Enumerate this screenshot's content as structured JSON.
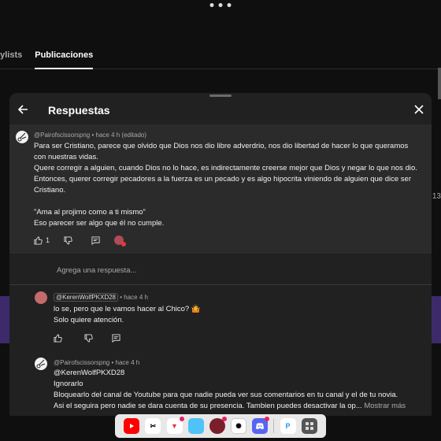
{
  "background": {
    "tab_prev": "aylists",
    "tab_active": "Publicaciones",
    "side_count": "13"
  },
  "panel": {
    "title": "Respuestas",
    "parent_comment": {
      "author": "@Pairofscissorspng",
      "time": "hace 4 h (editado)",
      "paragraphs": [
        "Para ser Cristiano, parece que olvido que Dios nos dio libre adverdrio, nos dio libertad de hacer lo que queramos con nuestras vidas.",
        "Quere corregir a alguien, cuando Dios no lo hace, es indirectamente creerse mejor que Dios y negar lo que nos dio. Entonces, querer corregir pecadores a la fuerza es un pecado y es algo hipocrita viniendo de alguien que dice ser Cristiano.",
        "",
        "\"Ama al projimo como a ti mismo\"",
        "Eso parecer ser algo que él no cumple."
      ],
      "likes": "1"
    },
    "reply_placeholder": "Agrega una respuesta...",
    "replies": [
      {
        "author": "@KerenWolfPKXD28",
        "time": "hace 4 h",
        "lines": [
          "lo se, pero que le vamos hacer al Chico? 🤷",
          "Solo quiere atención."
        ]
      },
      {
        "author": "@Pairofscissorspng",
        "time": "hace 4 h",
        "lines": [
          "@KerenWolfPKXD28",
          "Ignorarlo",
          "Bloquearlo del canal de Youtube para que nadie pueda ver sus comentarios en tu canal y el de tu novia.",
          "Asi el seguira pero nadie se dara cuenta de su presencia. Tambien puedes desactivar la op..."
        ],
        "more": "Mostrar más"
      }
    ]
  },
  "dock": {
    "apps": [
      "youtube-icon",
      "capcut-icon",
      "tubemate-icon",
      "ibis-paint-icon",
      "game-icon",
      "chatgpt-icon",
      "discord-icon",
      "picsart-icon",
      "app-grid-icon"
    ]
  },
  "colors": {
    "panel_bg": "#212121",
    "parent_bg": "#2b2b2b",
    "text": "#f1f1f1",
    "muted": "#aaaaaa"
  }
}
